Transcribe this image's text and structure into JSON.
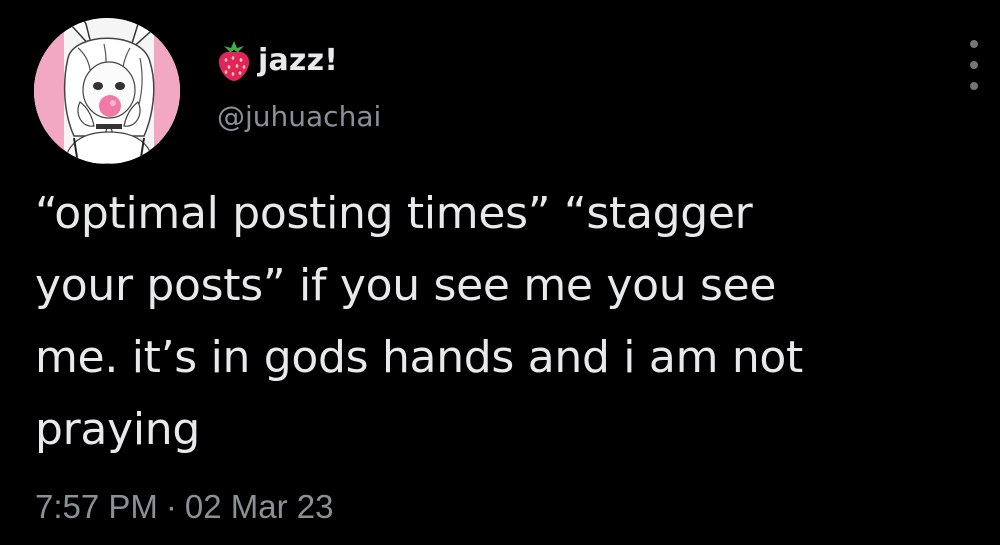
{
  "tweet": {
    "author": {
      "display_name": "jazz!",
      "name_emoji": "strawberry-icon",
      "handle": "@juhuachai",
      "avatar": "anime-girl-avatar"
    },
    "text": "“optimal posting times” “stagger\nyour posts” if you see me you see\nme. it’s in gods hands and i am not\npraying",
    "time": "7:57 PM",
    "separator": "·",
    "date": "02 Mar 23",
    "more_icon": "more-options-icon"
  },
  "colors": {
    "background": "#000000",
    "primary_text": "#e7e9ea",
    "secondary_text": "#8b9096",
    "avatar_accent": "#f2a7c3"
  }
}
